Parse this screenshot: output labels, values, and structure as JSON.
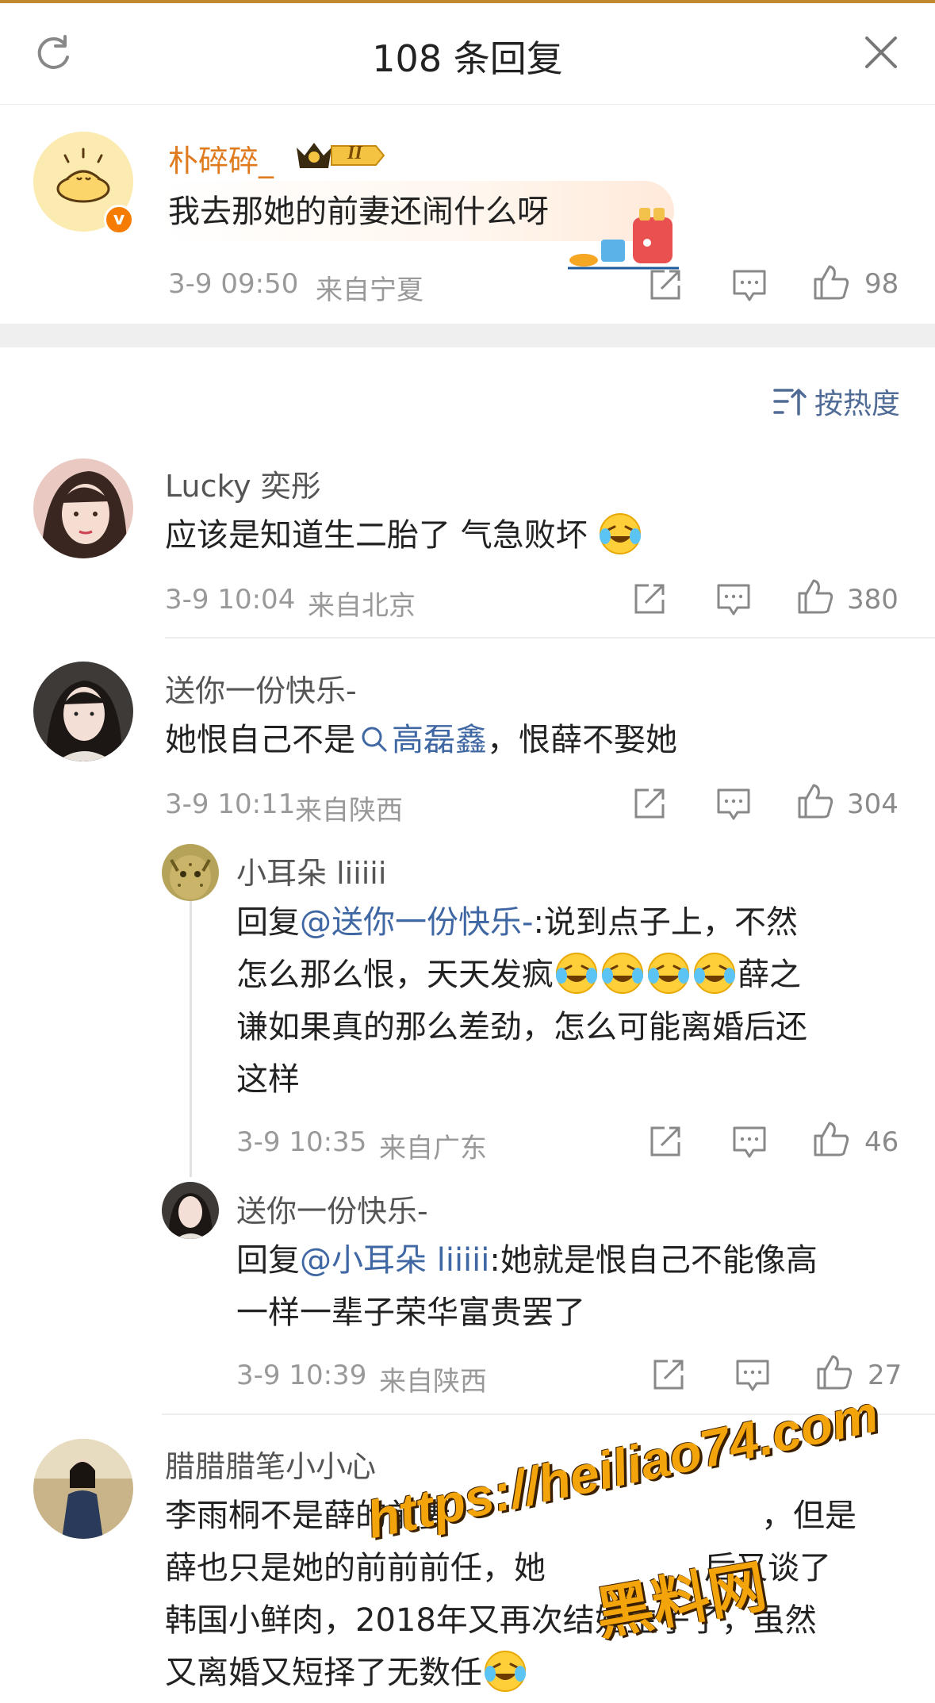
{
  "header": {
    "title": "108 条回复"
  },
  "main_comment": {
    "name": "朴碎碎_",
    "text": "我去那她的前妻还闹什么呀",
    "time": "3-9 09:50",
    "location": "来自宁夏",
    "likes": "98",
    "badge_text": "II"
  },
  "sort": {
    "label": "按热度"
  },
  "comments": [
    {
      "name": "Lucky 奕彤",
      "text": "应该是知道生二胎了 气急败坏",
      "time": "3-9 10:04",
      "location": "来自北京",
      "likes": "380"
    },
    {
      "name": "送你一份快乐-",
      "text_pre": "她恨自己不是",
      "link": "高磊鑫",
      "text_post": "，恨薛不娶她",
      "time": "3-9 10:11",
      "location": "来自陕西",
      "likes": "304"
    }
  ],
  "replies": [
    {
      "name": "小耳朵 liiiii",
      "prefix": "回复",
      "mention": "@送你一份快乐-",
      "line1": ":说到点子上，不然",
      "line2_pre": "怎么那么恨，天天发疯",
      "line2_post": "薛之",
      "line3": "谦如果真的那么差劲，怎么可能离婚后还",
      "line4": "这样",
      "time": "3-9 10:35",
      "location": "来自广东",
      "likes": "46"
    },
    {
      "name": "送你一份快乐-",
      "prefix": "回复",
      "mention": "@小耳朵 liiiii",
      "line1": ":她就是恨自己不能像高",
      "line2": "一样一辈子荣华富贵罢了",
      "time": "3-9 10:39",
      "location": "来自陕西",
      "likes": "27"
    }
  ],
  "last_comment": {
    "name": "腊腊腊笔小小心",
    "line1a": "李雨桐不是薛的前妻",
    "line1b": "，但是",
    "line2a": "薛也只是她的前前前任，她",
    "line2b": "后又谈了",
    "line3": "韩国小鲜肉，2018年又再次结婚生子了，虽然",
    "line4": "又离婚又短择了无数任"
  },
  "watermark": {
    "url": "https://heiliao74.com",
    "brand": "黑料网"
  },
  "colors": {
    "name_orange": "#e07a1f",
    "link_blue": "#3f67a3",
    "meta_gray": "#999999"
  }
}
